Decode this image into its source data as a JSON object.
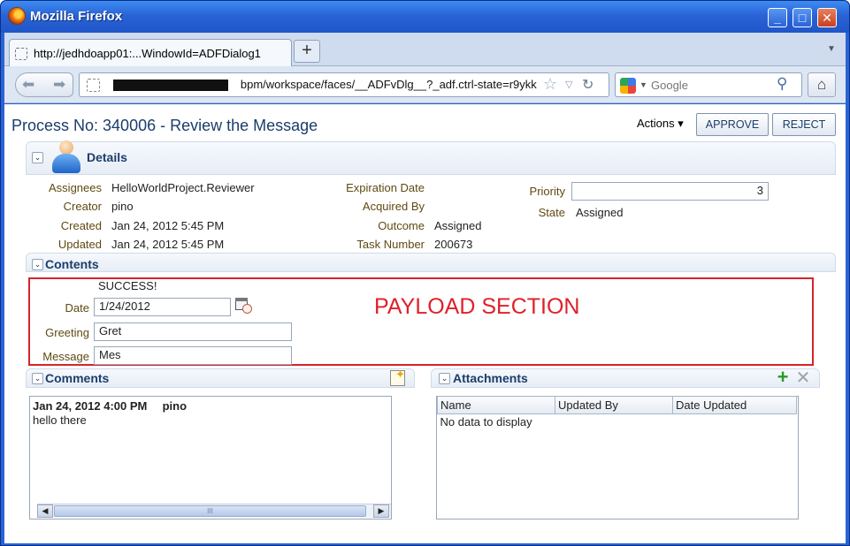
{
  "browser": {
    "app_title": "Mozilla Firefox",
    "tab_title": "http://jedhdoapp01:...WindowId=ADFDialog1",
    "new_tab": "+",
    "url": "bpm/workspace/faces/__ADFvDlg__?_adf.ctrl-state=r9ykk",
    "search_placeholder": "Google",
    "window_buttons": {
      "minimize": "_",
      "maximize": "□",
      "close": "✕"
    }
  },
  "header": {
    "title": "Process No: 340006 - Review the Message",
    "actions_label": "Actions ▾",
    "approve_label": "APPROVE",
    "reject_label": "REJECT"
  },
  "details": {
    "section_title": "Details",
    "assignees_label": "Assignees",
    "assignees_value": "HelloWorldProject.Reviewer",
    "creator_label": "Creator",
    "creator_value": "pino",
    "created_label": "Created",
    "created_value": "Jan 24, 2012 5:45 PM",
    "updated_label": "Updated",
    "updated_value": "Jan 24, 2012 5:45 PM",
    "expiration_label": "Expiration Date",
    "expiration_value": "",
    "acquired_label": "Acquired By",
    "acquired_value": "",
    "outcome_label": "Outcome",
    "outcome_value": "Assigned",
    "task_number_label": "Task Number",
    "task_number_value": "200673",
    "priority_label": "Priority",
    "priority_value": "3",
    "state_label": "State",
    "state_value": "Assigned"
  },
  "contents": {
    "section_title": "Contents",
    "status_text": "SUCCESS!",
    "date_label": "Date",
    "date_value": "1/24/2012",
    "greeting_label": "Greeting",
    "greeting_value": "Gret",
    "message_label": "Message",
    "message_value": "Mes",
    "payload_annotation": "PAYLOAD SECTION"
  },
  "comments": {
    "section_title": "Comments",
    "entries": [
      {
        "timestamp": "Jan 24, 2012 4:00 PM",
        "author": "pino",
        "text": "hello there"
      }
    ]
  },
  "attachments": {
    "section_title": "Attachments",
    "columns": [
      "Name",
      "Updated By",
      "Date Updated"
    ],
    "empty_message": "No data to display"
  },
  "colors": {
    "title_blue": "#1b3d6b",
    "label_brown": "#5f4a12",
    "payload_red": "#e0202a",
    "window_blue": "#2a63d6"
  },
  "icons": {
    "firefox": "firefox-logo-icon",
    "person": "user-avatar-icon",
    "calendar": "calendar-clock-icon",
    "add_comment": "add-comment-icon",
    "add": "add-green-icon",
    "delete": "delete-icon"
  }
}
